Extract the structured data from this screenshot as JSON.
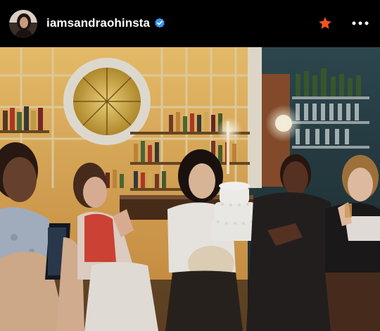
{
  "post": {
    "username": "iamsandraohinsta",
    "verified": true,
    "avatar_icon": "profile-photo",
    "favorite_icon": "star-icon",
    "favorite_color": "#f2541b",
    "more_icon": "more-options-icon",
    "verified_color": "#3797f0"
  }
}
